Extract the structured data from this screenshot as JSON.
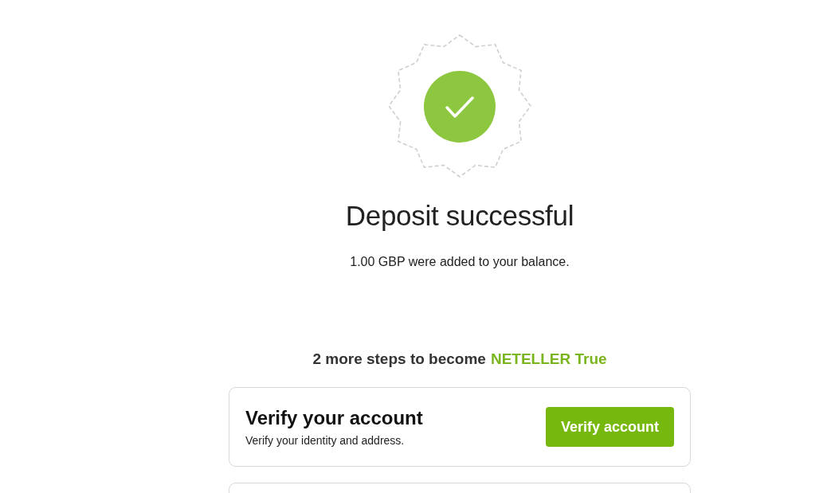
{
  "title": "Deposit successful",
  "message": "1.00 GBP were added to your balance.",
  "steps_heading": {
    "text": "2 more steps to become",
    "highlight": "NETELLER True"
  },
  "cards": [
    {
      "kind": "step",
      "title": "Verify your account",
      "description": "Verify your identity and address.",
      "button": "Verify account"
    },
    {
      "kind": "partial"
    }
  ]
}
